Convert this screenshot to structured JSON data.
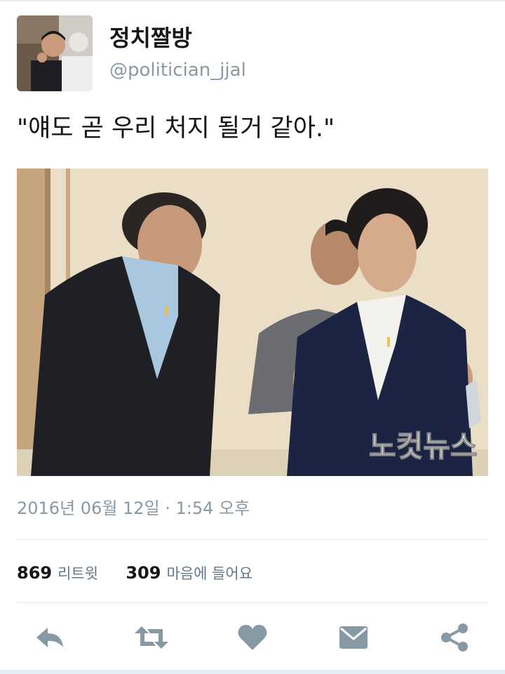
{
  "tweet": {
    "display_name": "정치짤방",
    "handle": "@politician_jjal",
    "text": "\"얘도 곧 우리 처지 될거 같아.\"",
    "timestamp": "2016년 06월 12일 · 1:54 오후",
    "photo_watermark": "노컷뉴스"
  },
  "stats": {
    "retweets_count": "869",
    "retweets_label": "리트윗",
    "likes_count": "309",
    "likes_label": "마음에 들어요"
  },
  "actions": {
    "icons": [
      "reply-icon",
      "retweet-icon",
      "heart-icon",
      "message-icon",
      "share-icon"
    ]
  },
  "colors": {
    "text": "#14171a",
    "muted": "#8899a6",
    "icon": "#8899a6",
    "divider": "#e1e8ed"
  }
}
